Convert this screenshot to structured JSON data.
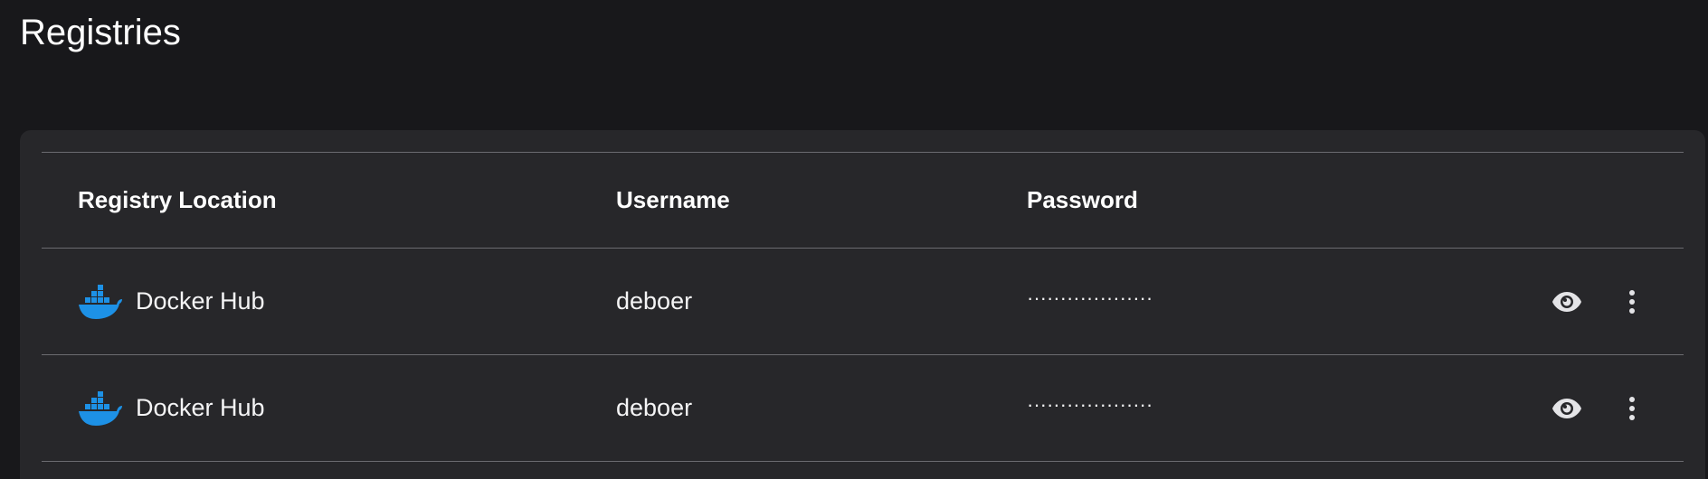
{
  "page": {
    "title": "Registries"
  },
  "table": {
    "columns": {
      "location": "Registry Location",
      "username": "Username",
      "password": "Password"
    },
    "rows": [
      {
        "icon": "docker-whale-icon",
        "location": "Docker Hub",
        "username": "deboer",
        "password": "···················"
      },
      {
        "icon": "docker-whale-icon",
        "location": "Docker Hub",
        "username": "deboer",
        "password": "···················"
      }
    ]
  },
  "colors": {
    "background": "#18181b",
    "panel": "#27272a",
    "divider": "#6b6b70",
    "docker_blue": "#1d91e6",
    "text": "#ffffff"
  }
}
